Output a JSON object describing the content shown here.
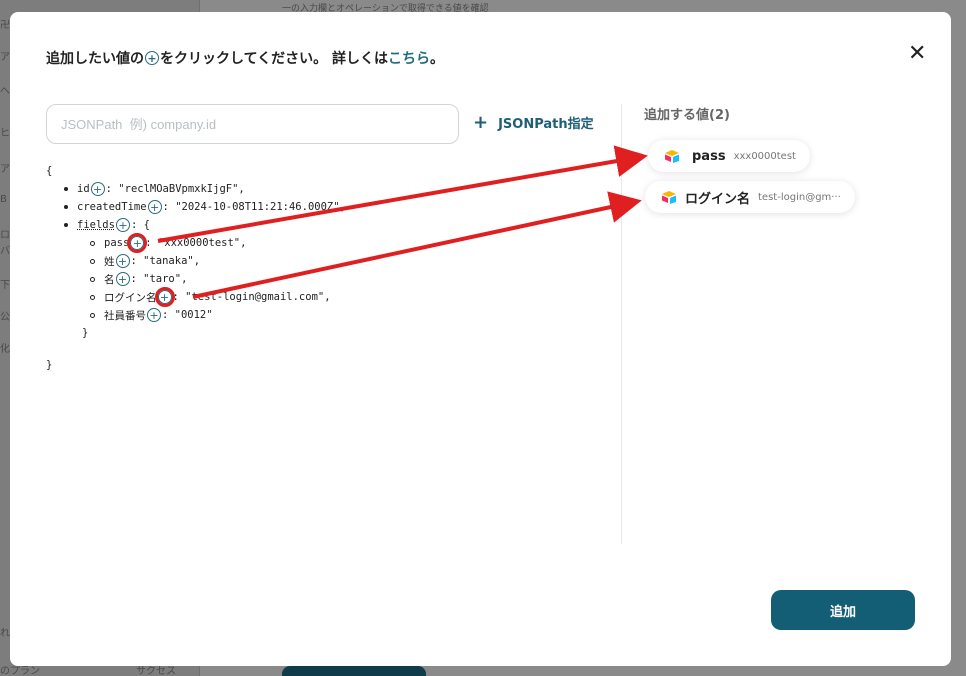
{
  "background": {
    "sidebar_snippets": [
      "卍",
      "ア",
      "へ",
      "ヒ",
      "ア",
      "B",
      "ロ",
      "バ",
      "下",
      "公",
      "化",
      "れ"
    ],
    "bottom_left": "のプラン",
    "bottom_mid": "サクセス",
    "top_text": "一の入力欄とオペレーションで取得できる値を確認"
  },
  "modal": {
    "title_before": "追加したい値の",
    "title_icon": "+",
    "title_after": "をクリックしてください。 詳しくは",
    "title_link": "こちら",
    "title_end": "。",
    "close_icon": "✕",
    "search_placeholder": "JSONPath  例) company.id",
    "jsonpath_button": "JSONPath指定",
    "jsonpath_plus": "+",
    "tree": {
      "open": "{",
      "close": "}",
      "id_key": "id",
      "id_value": ": \"reclMOaBVpmxkIjgF\",",
      "created_key": "createdTime",
      "created_value": ": \"2024-10-08T11:21:46.000Z\",",
      "fields_key": "fields",
      "fields_open": ": {",
      "fields_close": "}",
      "fields": [
        {
          "key": "pass",
          "value": ": \"xxx0000test\","
        },
        {
          "key": "姓",
          "value": ": \"tanaka\","
        },
        {
          "key": "名",
          "value": ": \"taro\","
        },
        {
          "key": "ログイン名",
          "value": ": \"test-login@gmail.com\","
        },
        {
          "key": "社員番号",
          "value": ": \"0012\""
        }
      ]
    },
    "added_title": "追加する値(2)",
    "added_items": [
      {
        "name": "pass",
        "value": "xxx0000test"
      },
      {
        "name": "ログイン名",
        "value": "test-login@gm···"
      }
    ],
    "submit_button": "追加",
    "colors": {
      "accent": "#135e75",
      "link": "#1f6b82",
      "annotation": "#e02020"
    }
  }
}
